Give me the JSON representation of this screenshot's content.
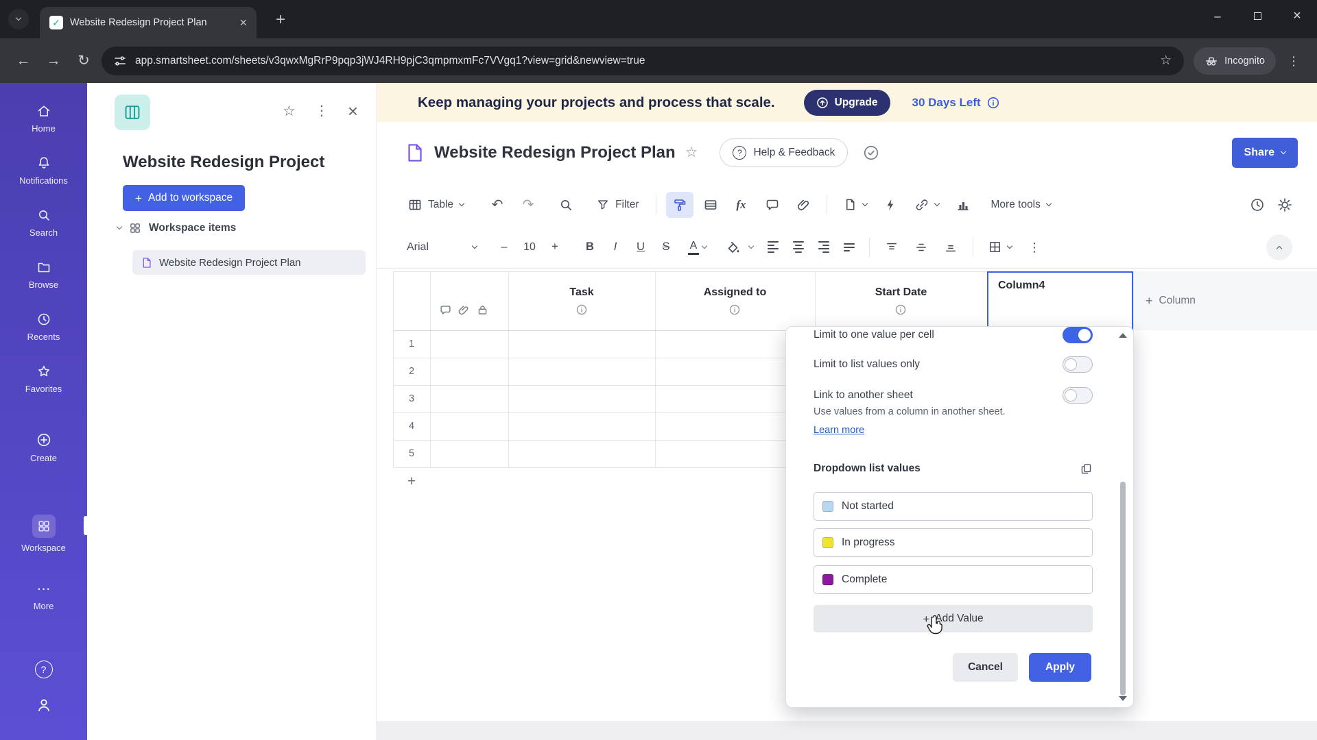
{
  "colors": {
    "accent_blue": "#4361e4",
    "rail_purple_top": "#4a3eb0",
    "rail_purple_bottom": "#5c4fd4",
    "banner_bg": "#fbf5e1",
    "upgrade_navy": "#2c3170",
    "trial_blue": "#3c5be4",
    "toggle_on": "#3d63e6",
    "selected_column_border": "#3a62e2"
  },
  "browser": {
    "tab_title": "Website Redesign Project Plan",
    "url": "app.smartsheet.com/sheets/v3qwxMgRrP9pqp3jWJ4RH9pjC3qmpmxmFc7VVgq1?view=grid&newview=true",
    "incognito_label": "Incognito"
  },
  "nav_rail": {
    "items": [
      {
        "label": "Home",
        "icon": "home-icon"
      },
      {
        "label": "Notifications",
        "icon": "bell-icon"
      },
      {
        "label": "Search",
        "icon": "search-icon"
      },
      {
        "label": "Browse",
        "icon": "folder-icon"
      },
      {
        "label": "Recents",
        "icon": "clock-icon"
      },
      {
        "label": "Favorites",
        "icon": "star-icon"
      },
      {
        "label": "Create",
        "icon": "plus-circle-icon"
      },
      {
        "label": "Workspace",
        "icon": "workspace-grid-icon",
        "active": true
      },
      {
        "label": "More",
        "icon": "ellipsis-icon"
      }
    ]
  },
  "workspace_panel": {
    "title": "Website Redesign Project",
    "add_to_workspace_label": "Add to workspace",
    "section_label": "Workspace items",
    "item_label": "Website Redesign Project Plan"
  },
  "banner": {
    "message": "Keep managing your projects and process that scale.",
    "upgrade_label": "Upgrade",
    "trial_label": "30 Days Left"
  },
  "sheet_header": {
    "title": "Website Redesign Project Plan",
    "help_label": "Help & Feedback",
    "share_label": "Share"
  },
  "toolbar_primary": {
    "view_label": "Table",
    "filter_label": "Filter",
    "formula_label": "fx",
    "more_tools_label": "More tools"
  },
  "toolbar_format": {
    "font_name": "Arial",
    "font_size": "10",
    "bold": "B",
    "italic": "I",
    "underline": "U",
    "strikethrough": "S",
    "text_color_letter": "A"
  },
  "grid": {
    "columns": [
      "Task",
      "Assigned to",
      "Start Date",
      "Column4"
    ],
    "add_column_label": "Column",
    "row_numbers": [
      "1",
      "2",
      "3",
      "4",
      "5"
    ]
  },
  "column_settings": {
    "options": [
      {
        "label": "Limit to one value per cell",
        "enabled": true
      },
      {
        "label": "Limit to list values only",
        "enabled": false
      },
      {
        "label": "Link to another sheet",
        "enabled": false
      }
    ],
    "link_description": "Use values from a column in another sheet.",
    "learn_more_label": "Learn more",
    "list_values_label": "Dropdown list values",
    "values": [
      {
        "label": "Not started",
        "color": "#b9d7f1"
      },
      {
        "label": "In progress",
        "color": "#f0e42f"
      },
      {
        "label": "Complete",
        "color": "#8d1a9e"
      }
    ],
    "add_value_label": "Add Value",
    "cancel_label": "Cancel",
    "apply_label": "Apply"
  }
}
